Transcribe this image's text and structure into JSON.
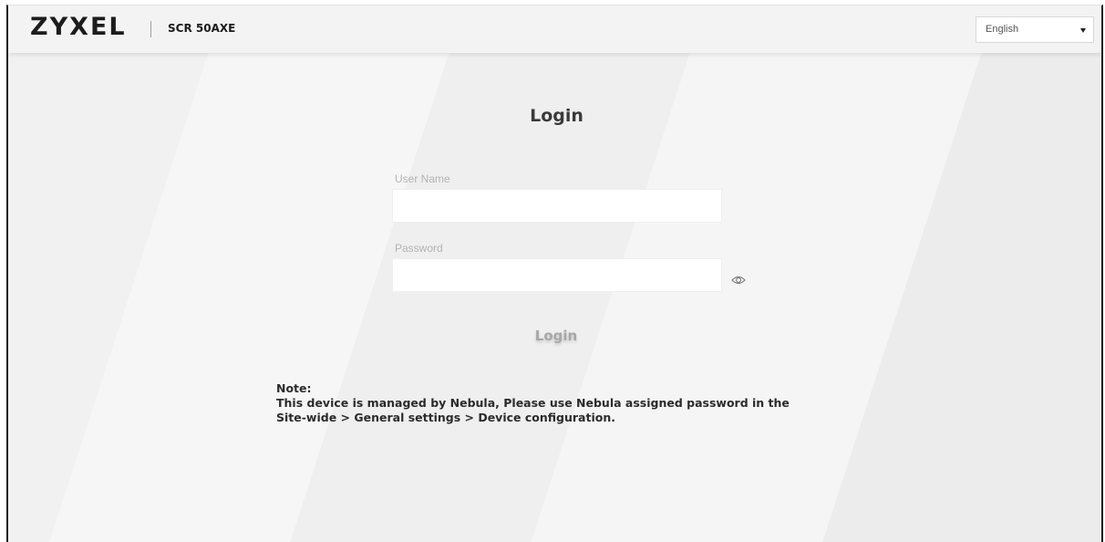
{
  "header": {
    "logo_text": "ZYXEL",
    "model": "SCR 50AXE",
    "language": {
      "selected": "English"
    }
  },
  "login": {
    "title": "Login",
    "username_label": "User Name",
    "username_value": "",
    "password_label": "Password",
    "password_value": "",
    "submit_label": "Login"
  },
  "note": {
    "heading": "Note:",
    "line1": "This device is managed by Nebula, Please use Nebula assigned password in the",
    "line2": "Site-wide > General settings > Device configuration."
  },
  "icons": {
    "password_toggle": "eye-icon",
    "language_caret": "caret-down-icon"
  },
  "colors": {
    "background": "#f3f3f3",
    "title_text": "#3a3a3a",
    "label_text": "#b3b3b3",
    "login_button_text": "#a7a7a7",
    "note_text": "#2b2b2b"
  }
}
